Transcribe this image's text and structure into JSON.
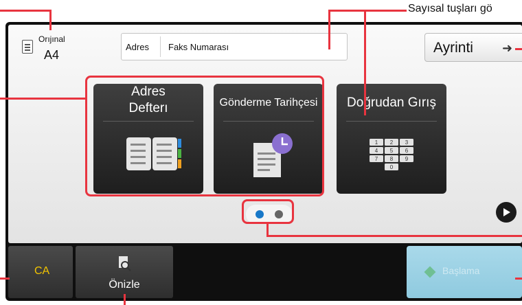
{
  "annotation": {
    "text": "Sayısal tuşları gö"
  },
  "header": {
    "original_label": "Orıjınal",
    "original_value": "A4",
    "address_label": "Adres",
    "address_value": "Faks Numarası",
    "detail_button": "Ayrinti"
  },
  "tiles": [
    {
      "title_line1": "Adres",
      "title_line2": "Defterı",
      "icon": "address-book-icon"
    },
    {
      "title": "Gönderme Tarihçesi",
      "icon": "send-history-icon"
    },
    {
      "title": "Doğrudan Gırış",
      "icon": "keypad-icon"
    }
  ],
  "keypad": [
    "1",
    "2",
    "3",
    "4",
    "5",
    "6",
    "7",
    "8",
    "9",
    "0"
  ],
  "pagination": {
    "total": 2,
    "active": 1
  },
  "footer": {
    "ca_label": "CA",
    "preview_label": "Önizle",
    "start_label": "Başlama"
  },
  "colors": {
    "callout": "#e8343f",
    "accent_blue": "#1878c8",
    "ca_text": "#f2c400",
    "start_bg": "#a9d9ea",
    "clock_purple": "#8a6fd0"
  }
}
